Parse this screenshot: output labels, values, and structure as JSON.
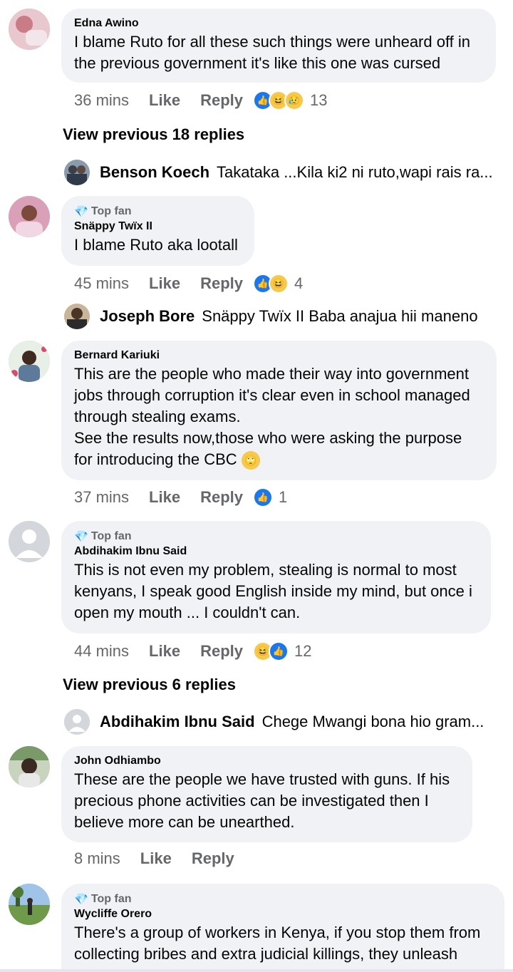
{
  "comments": [
    {
      "name": "Edna Awino",
      "text": "I blame Ruto for all these such things were unheard off in the previous government it's like this one was cursed",
      "time": "36 mins",
      "like": "Like",
      "reply": "Reply",
      "reactions": "13",
      "reaction_icons": [
        "like-icon",
        "haha-icon",
        "sad-icon"
      ]
    },
    {
      "badge": "Top fan",
      "name": "Snäppy Twïx II",
      "text": "I blame Ruto aka lootall",
      "time": "45 mins",
      "like": "Like",
      "reply": "Reply",
      "reactions": "4",
      "reaction_icons": [
        "like-icon",
        "haha-icon"
      ]
    },
    {
      "name": "Bernard Kariuki",
      "text_lines": [
        "This are the people who made their way into government",
        "jobs through corruption it's clear even in school managed",
        "through stealing exams.",
        "See the results now,those who were asking the purpose",
        "for introducing the CBC"
      ],
      "time": "37 mins",
      "like": "Like",
      "reply": "Reply",
      "reactions": "1",
      "reaction_icons": [
        "like-icon"
      ]
    },
    {
      "badge": "Top fan",
      "name": "Abdihakim Ibnu Said",
      "text_lines": [
        "This is not even my problem, stealing is normal to most",
        "kenyans, I speak good English inside my mind, but once i",
        "open my mouth ... I couldn't can."
      ],
      "time": "44 mins",
      "like": "Like",
      "reply": "Reply",
      "reactions": "12",
      "reaction_icons": [
        "haha-icon",
        "like-icon"
      ]
    },
    {
      "name": "John Odhiambo",
      "text_lines": [
        "These are the people we have trusted with guns. If his",
        "precious phone activities can be investigated then I",
        "believe more can be unearthed."
      ],
      "time": "8 mins",
      "like": "Like",
      "reply": "Reply"
    },
    {
      "badge": "Top fan",
      "name": "Wycliffe Orero",
      "text_lines": [
        "There's a group of workers in Kenya, if you stop them from",
        "collecting bribes and extra judicial killings, they unleash"
      ]
    }
  ],
  "view_previous": [
    "View previous 18 replies",
    "View previous 6 replies"
  ],
  "replies": [
    {
      "name": "Benson Koech",
      "text": "Takataka ...Kila ki2 ni ruto,wapi rais ra..."
    },
    {
      "name": "Joseph Bore",
      "text": "Snäppy Twïx II Baba anajua hii maneno"
    },
    {
      "name": "Abdihakim Ibnu Said",
      "text": "Chege Mwangi bona hio gram..."
    }
  ],
  "colors": {
    "bubble": "#f0f2f5",
    "meta": "#65676b",
    "like_blue": "#1877f2",
    "emoji_yellow": "#f7c94a"
  }
}
